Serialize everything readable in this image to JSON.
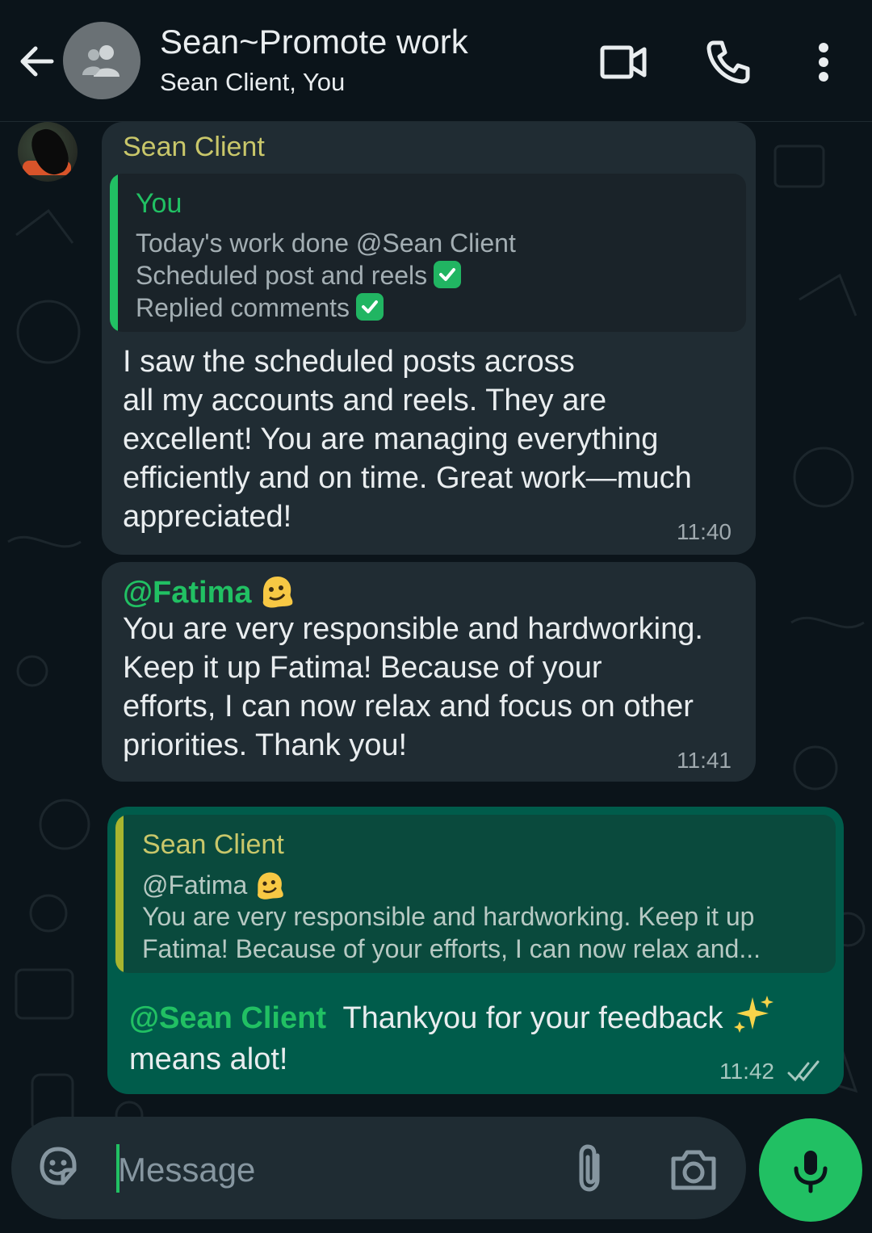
{
  "header": {
    "title": "Sean~Promote work",
    "subtitle": "Sean Client, You"
  },
  "messages": {
    "m1": {
      "sender": "Sean Client",
      "quote": {
        "author": "You",
        "line1": "Today's work done @Sean Client",
        "line2": "Scheduled post and reels",
        "line3": "Replied comments"
      },
      "lines": [
        "I saw the scheduled posts across",
        "all my accounts and reels. They are",
        "excellent! You are managing everything",
        "efficiently and on time. Great work—much",
        "appreciated!"
      ],
      "time": "11:40"
    },
    "m2": {
      "mention": "@Fatima",
      "lines": [
        "You are very responsible and hardworking.",
        "Keep it up Fatima! Because of your",
        "efforts, I can now relax and focus on other",
        "priorities. Thank you!"
      ],
      "time": "11:41"
    },
    "m3": {
      "quote": {
        "author": "Sean Client",
        "line1": "@Fatima",
        "line2": "You are very responsible and hardworking. Keep it up",
        "line3": "Fatima! Because of your efforts, I can now relax and..."
      },
      "mention": "@Sean Client",
      "text1": "Thankyou for your feedback",
      "text2": "means alot!",
      "time": "11:42"
    }
  },
  "input": {
    "placeholder": "Message"
  },
  "colors": {
    "background": "#0b141a",
    "incoming_bubble": "#202c33",
    "outgoing_bubble": "#005c4b",
    "accent_green": "#21c063",
    "sender_name": "#c9c76a"
  },
  "icons": [
    "back-arrow-icon",
    "group-avatar-icon",
    "video-call-icon",
    "phone-icon",
    "more-vert-icon",
    "sticker-icon",
    "attach-icon",
    "camera-icon",
    "mic-icon",
    "check-mark-icon",
    "melting-face-emoji",
    "sparkles-emoji",
    "double-check-icon"
  ]
}
